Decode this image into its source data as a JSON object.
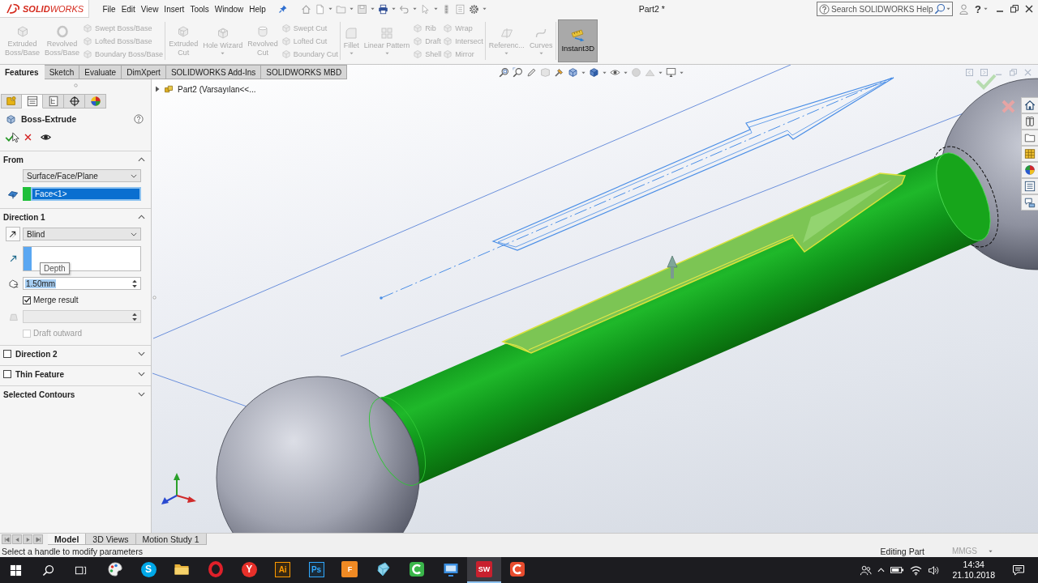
{
  "titlebar": {
    "logo": "**SOLID**WORKS",
    "menu": [
      "File",
      "Edit",
      "View",
      "Insert",
      "Tools",
      "Window",
      "Help"
    ],
    "title": "Part2 *",
    "search": {
      "placeholder": "Search SOLIDWORKS Help"
    },
    "help_button": "?"
  },
  "ribbon": {
    "groups": [
      {
        "items": [
          {
            "kind": "large",
            "label": "Extruded\nBoss/Base",
            "disabled": true,
            "on": false,
            "menu": false
          },
          {
            "kind": "large",
            "label": "Revolved\nBoss/Base",
            "disabled": true,
            "on": false,
            "menu": false
          },
          {
            "kind": "stack",
            "commands": [
              {
                "label": "Swept Boss/Base",
                "disabled": true
              },
              {
                "label": "Lofted Boss/Base",
                "disabled": true
              },
              {
                "label": "Boundary Boss/Base",
                "disabled": true
              }
            ]
          }
        ]
      },
      {
        "items": [
          {
            "kind": "large",
            "label": "Extruded\nCut",
            "disabled": true,
            "on": false,
            "menu": false
          },
          {
            "kind": "large",
            "label": "Hole Wizard",
            "disabled": true,
            "on": false,
            "menu": true
          },
          {
            "kind": "large",
            "label": "Revolved\nCut",
            "disabled": true,
            "on": false,
            "menu": false
          },
          {
            "kind": "stack",
            "commands": [
              {
                "label": "Swept Cut",
                "disabled": true
              },
              {
                "label": "Lofted Cut",
                "disabled": true
              },
              {
                "label": "Boundary Cut",
                "disabled": true
              }
            ]
          }
        ]
      },
      {
        "items": [
          {
            "kind": "large",
            "label": "Fillet",
            "disabled": true,
            "on": false,
            "menu": true
          },
          {
            "kind": "large",
            "label": "Linear Pattern",
            "disabled": true,
            "on": false,
            "menu": true
          },
          {
            "kind": "stack",
            "commands": [
              {
                "label": "Rib",
                "disabled": true
              },
              {
                "label": "Draft",
                "disabled": true
              },
              {
                "label": "Shell",
                "disabled": true
              }
            ]
          },
          {
            "kind": "stack",
            "commands": [
              {
                "label": "Wrap",
                "disabled": true
              },
              {
                "label": "Intersect",
                "disabled": true
              },
              {
                "label": "Mirror",
                "disabled": true
              }
            ]
          }
        ]
      },
      {
        "items": [
          {
            "kind": "large",
            "label": "Referenc...",
            "disabled": true,
            "on": false,
            "menu": true
          },
          {
            "kind": "large",
            "label": "Curves",
            "disabled": true,
            "on": false,
            "menu": true
          }
        ]
      },
      {
        "items": [
          {
            "kind": "large",
            "label": "Instant3D",
            "disabled": false,
            "on": true,
            "menu": false
          }
        ]
      }
    ]
  },
  "command_tabs": [
    {
      "label": "Features",
      "selected": true
    },
    {
      "label": "Sketch",
      "selected": false
    },
    {
      "label": "Evaluate",
      "selected": false
    },
    {
      "label": "DimXpert",
      "selected": false
    },
    {
      "label": "SOLIDWORKS Add-Ins",
      "selected": false
    },
    {
      "label": "SOLIDWORKS MBD",
      "selected": false
    }
  ],
  "property_manager": {
    "tabs": [
      {
        "selected": false
      },
      {
        "selected": true
      },
      {
        "selected": false
      },
      {
        "selected": false
      },
      {
        "selected": false
      }
    ],
    "title": "Boss-Extrude",
    "sections": [
      {
        "kind": "plain",
        "title": "From",
        "expanded": true,
        "rows": [
          {
            "kind": "dropdown",
            "value": "Surface/Face/Plane"
          },
          {
            "kind": "selection",
            "value": "Face<1>",
            "color": "#1fbf3a",
            "selected": true
          }
        ]
      },
      {
        "kind": "plain",
        "title": "Direction 1",
        "expanded": true,
        "rows": [
          {
            "kind": "endcondition",
            "value": "Blind"
          },
          {
            "kind": "direction",
            "color": "#5aa7f2",
            "tooltip": "Depth"
          },
          {
            "kind": "spinner",
            "value": "1.50mm",
            "selected": true,
            "disabled": false
          },
          {
            "kind": "checkbox",
            "label": "Merge result",
            "checked": true,
            "disabled": false
          },
          {
            "kind": "spinner",
            "selected": false,
            "disabled": true
          },
          {
            "kind": "checkbox",
            "label": "Draft outward",
            "checked": false,
            "disabled": true
          }
        ]
      },
      {
        "kind": "check",
        "title": "Direction 2",
        "checked": false,
        "expanded": false
      },
      {
        "kind": "check",
        "title": "Thin Feature",
        "checked": false,
        "expanded": false
      },
      {
        "kind": "plain",
        "title": "Selected Contours",
        "expanded": false
      }
    ]
  },
  "viewport": {
    "tree": {
      "label": "Part2  (Varsayılan<<...",
      "expanded": false
    }
  },
  "bottom_tabs": [
    {
      "label": "Model",
      "selected": true
    },
    {
      "label": "3D Views",
      "selected": false
    },
    {
      "label": "Motion Study 1",
      "selected": false
    }
  ],
  "status_bar": {
    "message": "Select a handle to modify parameters",
    "mode": "Editing Part",
    "units": "MMGS"
  },
  "taskbar": {
    "apps": [
      {
        "kind": "palette",
        "selected": false
      },
      {
        "kind": "disc",
        "label": "S",
        "color": "#00a8e8",
        "selected": false
      },
      {
        "kind": "folder",
        "selected": false
      },
      {
        "kind": "ring",
        "color": "#e0202a",
        "selected": false
      },
      {
        "kind": "disc",
        "label": "Y",
        "color": "#e8302a",
        "selected": false
      },
      {
        "kind": "tile",
        "label": "Ai",
        "color": "#ff9a00",
        "selected": false
      },
      {
        "kind": "tile",
        "label": "Ps",
        "color": "#31a8ff",
        "selected": false
      },
      {
        "kind": "block",
        "label": "F",
        "color": "#f08a24",
        "selected": false
      },
      {
        "kind": "crystal",
        "selected": false
      },
      {
        "kind": "arc",
        "color": "#3ab54a",
        "selected": false
      },
      {
        "kind": "screen",
        "selected": false
      },
      {
        "kind": "block",
        "label": "SW",
        "color": "#c8202e",
        "selected": true
      },
      {
        "kind": "arc",
        "color": "#e84c2e",
        "selected": false
      }
    ],
    "clock": {
      "time": "14:34",
      "date": "21.10.2018"
    }
  }
}
